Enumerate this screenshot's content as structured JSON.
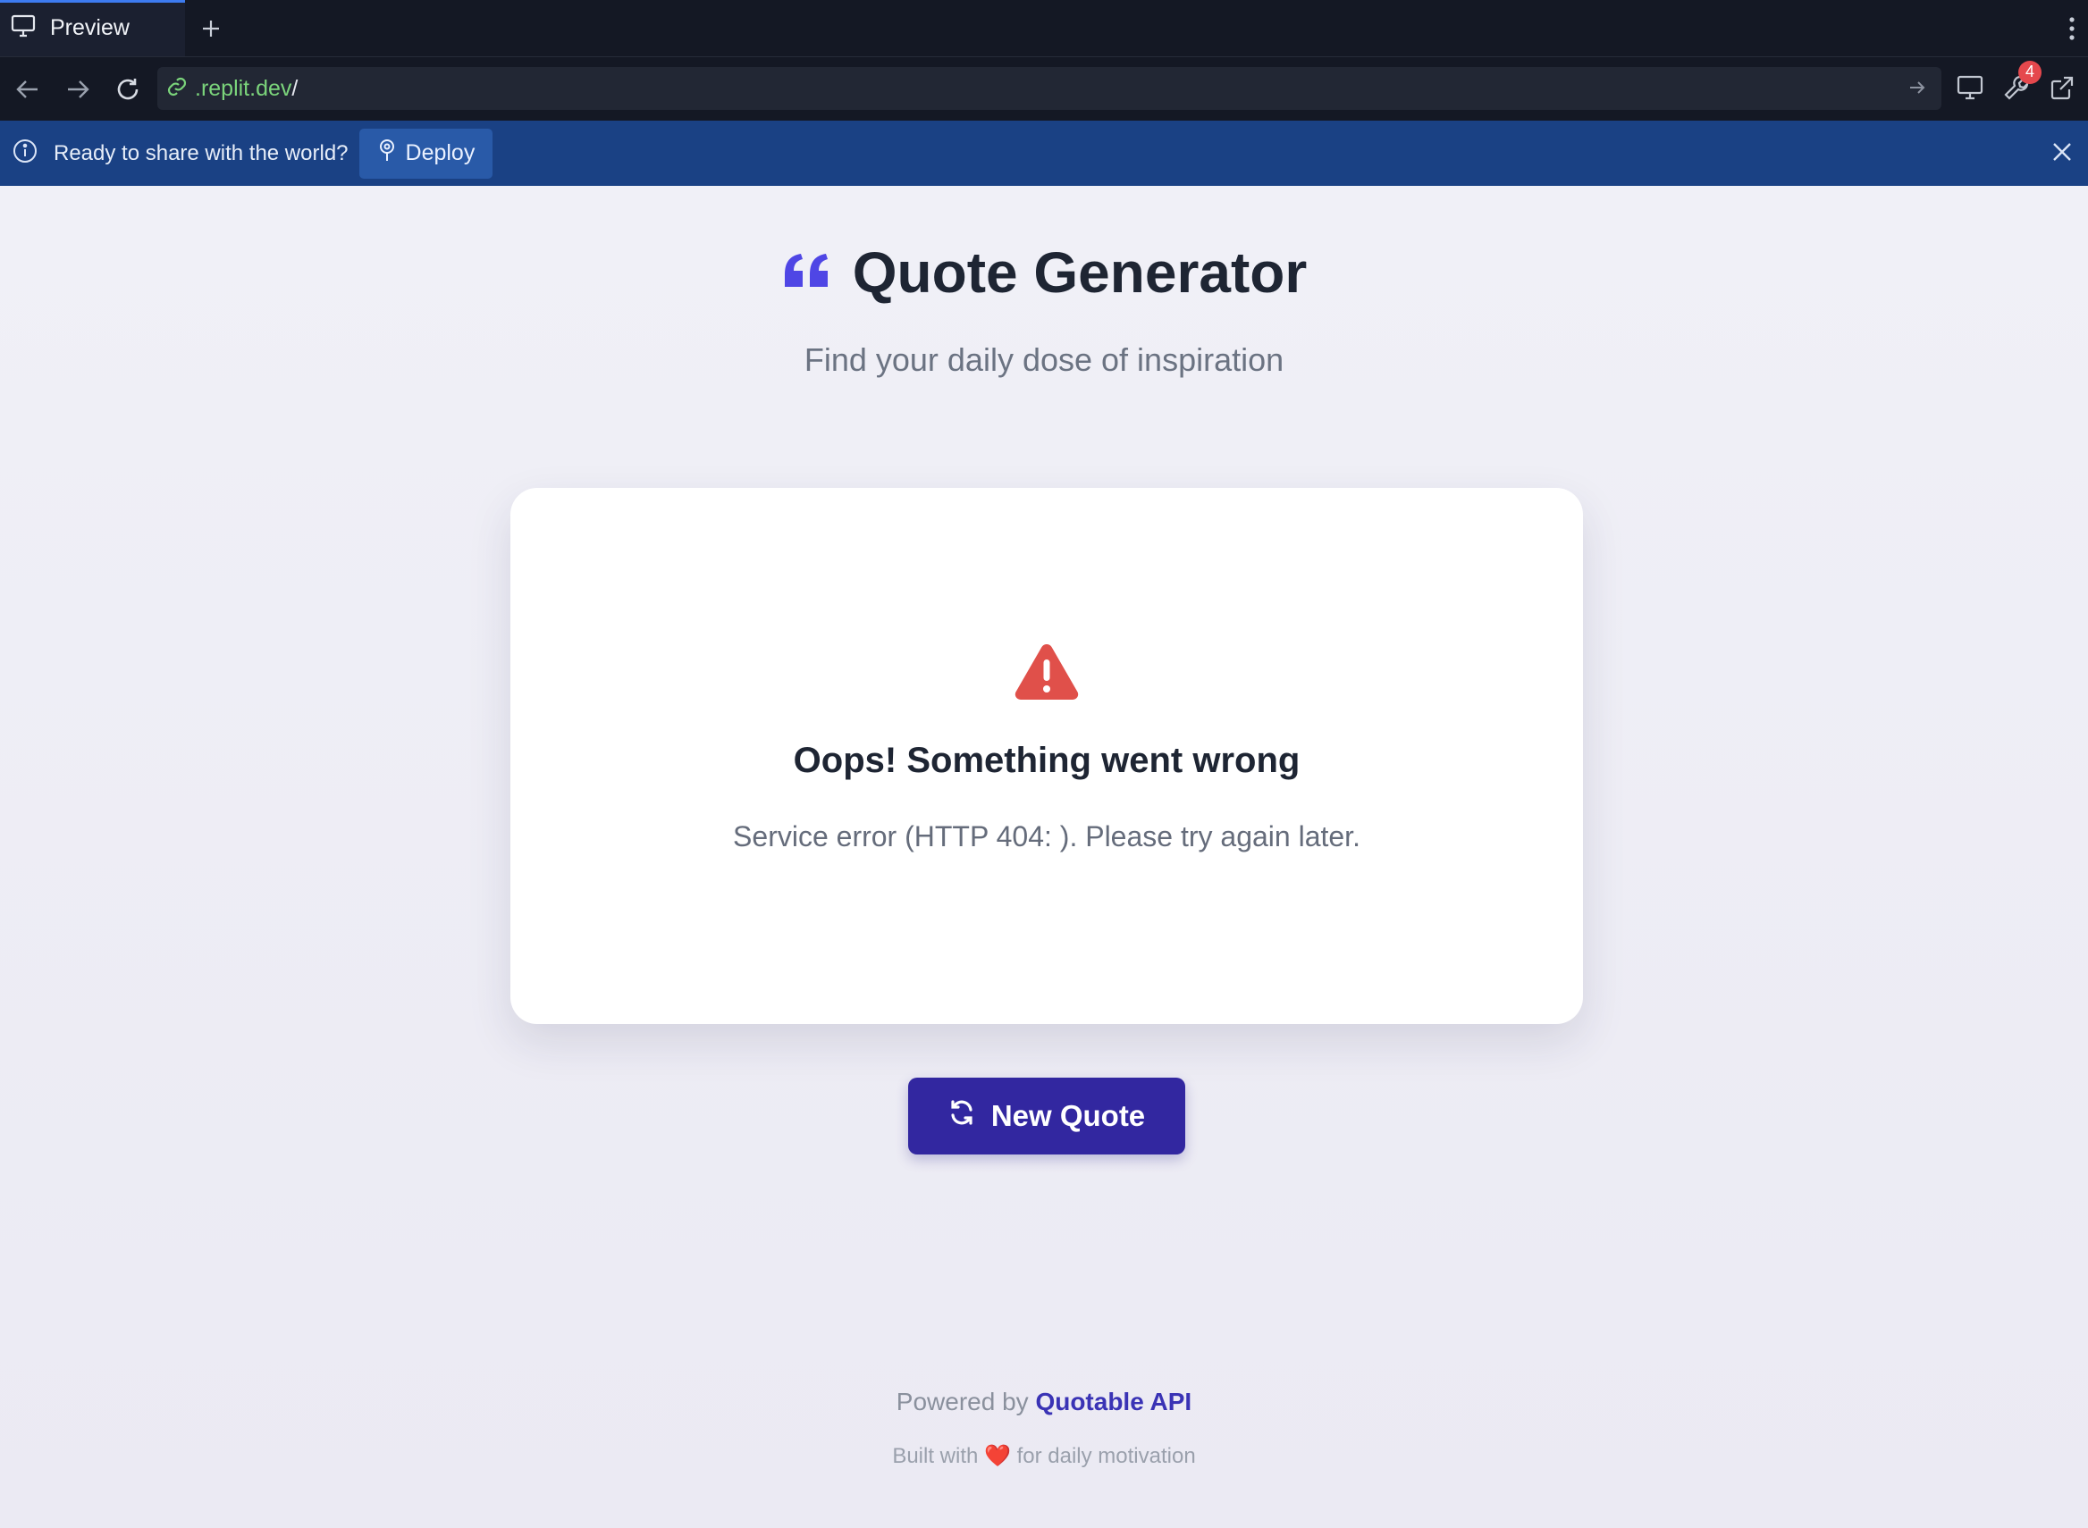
{
  "browser": {
    "tab_label": "Preview",
    "url": ".replit.dev",
    "url_suffix": "/",
    "notification_count": "4"
  },
  "banner": {
    "message": "Ready to share with the world?",
    "deploy_label": "Deploy"
  },
  "app": {
    "title": "Quote Generator",
    "subtitle": "Find your daily dose of inspiration",
    "accent_color": "#4f46e5"
  },
  "error": {
    "title": "Oops! Something went wrong",
    "message": "Service error (HTTP 404: ). Please try again later.",
    "icon_color": "#e0504a"
  },
  "actions": {
    "new_quote_label": "New Quote"
  },
  "footer": {
    "powered_by": "Powered by",
    "api_name": "Quotable API",
    "built_prefix": "Built with",
    "heart": "❤️",
    "built_suffix": "for daily motivation"
  }
}
